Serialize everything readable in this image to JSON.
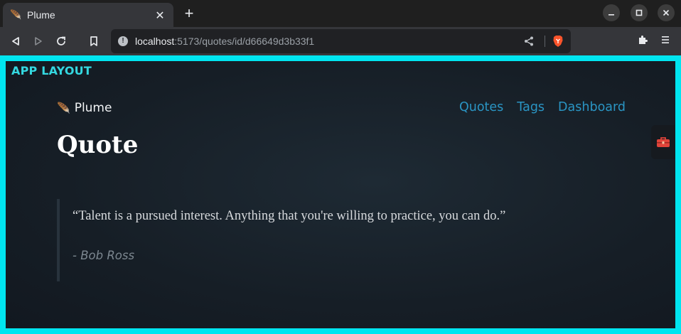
{
  "browser": {
    "tab": {
      "title": "Plume",
      "favicon": "feather-icon"
    },
    "address_bar": {
      "host": "localhost",
      "path": ":5173/quotes/id/d66649d3b33f1"
    }
  },
  "app": {
    "layout_label": "APP LAYOUT",
    "brand": {
      "icon": "🪶",
      "name": "Plume"
    },
    "nav": [
      {
        "label": "Quotes"
      },
      {
        "label": "Tags"
      },
      {
        "label": "Dashboard"
      }
    ],
    "page_title": "Quote",
    "quote": {
      "text": "“Talent is a pursued interest. Anything that you're willing to practice, you can do.”",
      "author": "- Bob Ross"
    }
  },
  "colors": {
    "frame_accent": "#00e5f0",
    "layout_label": "#34d8e0",
    "nav_link": "#2a95c4",
    "background": "#161e26"
  }
}
